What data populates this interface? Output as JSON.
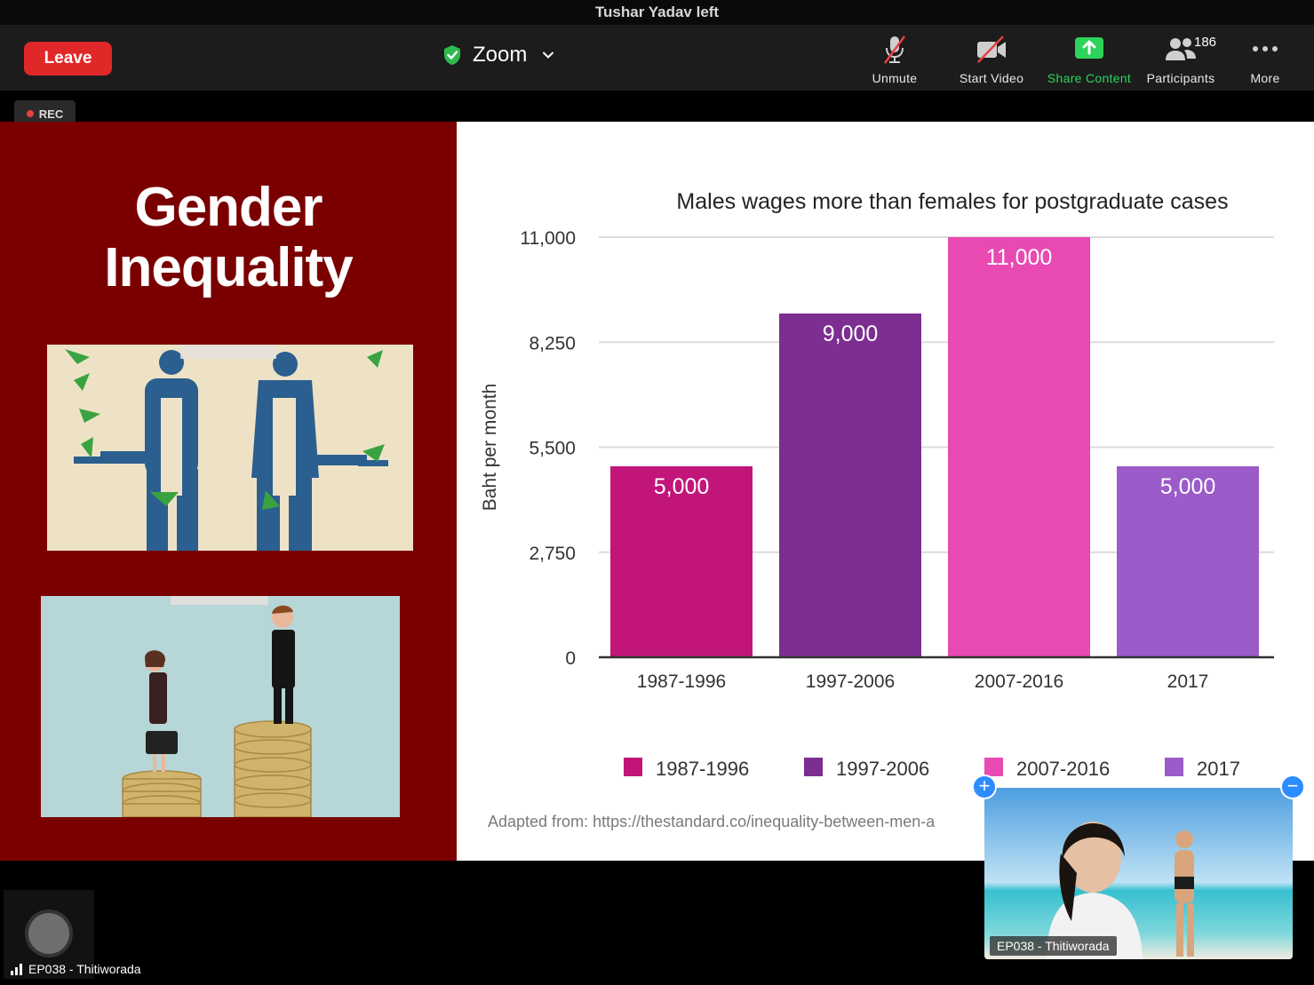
{
  "notification": "Tushar Yadav left",
  "toolbar": {
    "leave_label": "Leave",
    "meeting_name": "Zoom",
    "items": [
      {
        "label": "Unmute",
        "icon": "microphone-muted-icon"
      },
      {
        "label": "Start Video",
        "icon": "video-off-icon"
      },
      {
        "label": "Share Content",
        "icon": "share-arrow-icon"
      },
      {
        "label": "Participants",
        "icon": "participants-icon",
        "count": "186"
      },
      {
        "label": "More",
        "icon": "more-dots-icon"
      }
    ]
  },
  "recording": {
    "label": "REC"
  },
  "slide": {
    "title_line1": "Gender",
    "title_line2": "Inequality",
    "source": "Adapted from: https://thestandard.co/inequality-between-men-a",
    "background_color": "#7a0000"
  },
  "chart_data": {
    "type": "bar",
    "title": "Males wages more than females for postgraduate cases",
    "xlabel": "",
    "ylabel": "Baht per month",
    "categories": [
      "1987-1996",
      "1997-2006",
      "2007-2016",
      "2017"
    ],
    "values": [
      5000,
      9000,
      11000,
      5000
    ],
    "value_labels": [
      "5,000",
      "9,000",
      "11,000",
      "5,000"
    ],
    "colors": [
      "#c2157a",
      "#7d2e91",
      "#e84ab2",
      "#9b5bc9"
    ],
    "ylim": [
      0,
      11000
    ],
    "yticks": [
      0,
      2750,
      5500,
      8250,
      11000
    ],
    "ytick_labels": [
      "0",
      "2,750",
      "5,500",
      "8,250",
      "11,000"
    ],
    "legend": [
      "1987-1996",
      "1997-2006",
      "2007-2016",
      "2017"
    ],
    "legend_position": "bottom",
    "grid": true
  },
  "self_view": {
    "name": "EP038 - Thitiworada"
  },
  "bottom_participant": {
    "name": "EP038 - Thitiworada"
  }
}
